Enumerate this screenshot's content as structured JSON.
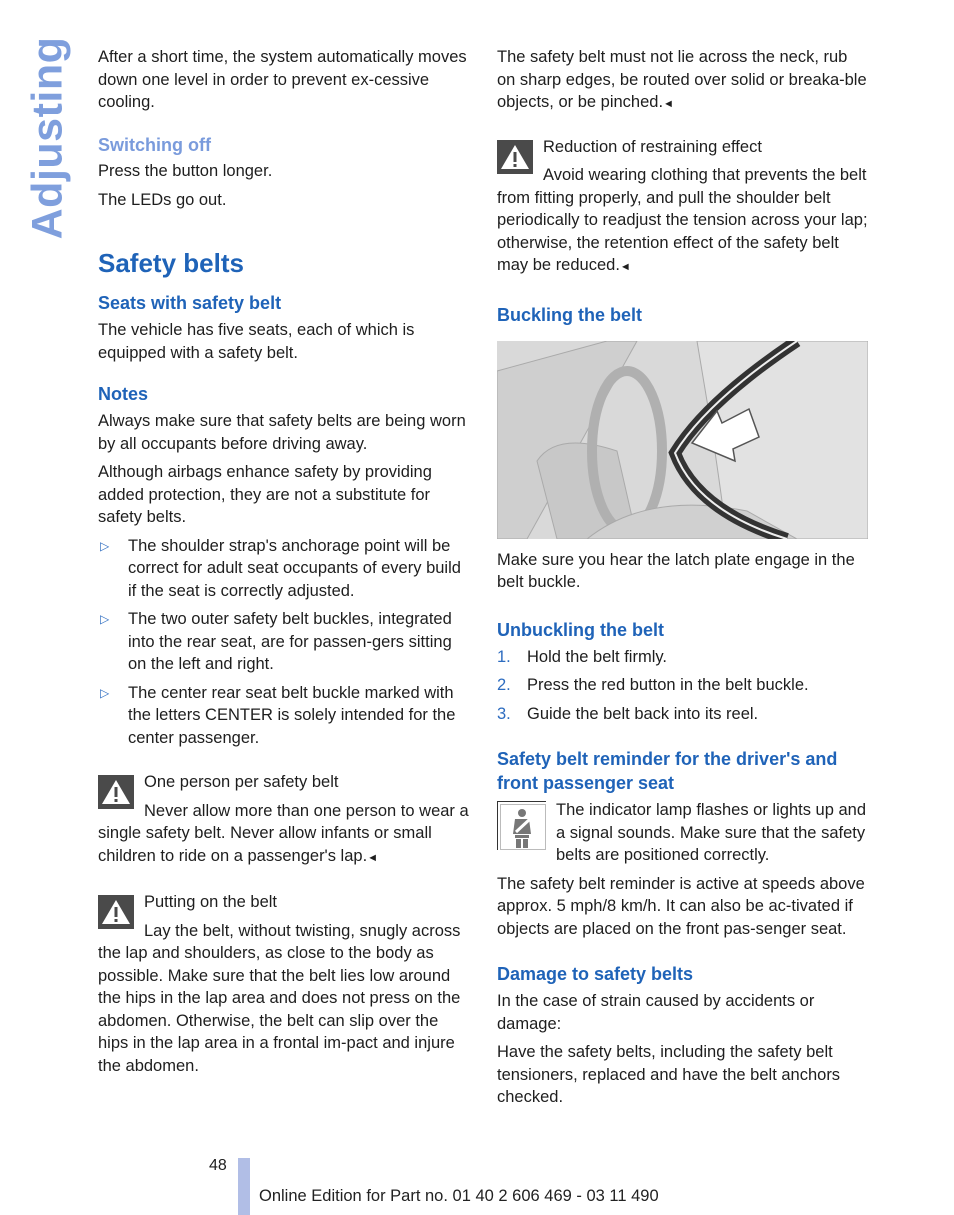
{
  "side_tab": {
    "label": "Adjusting"
  },
  "left": {
    "intro": "After a short time, the system automatically moves down one level in order to prevent ex-cessive cooling.",
    "switching_off": {
      "heading": "Switching off",
      "p1": "Press the button longer.",
      "p2": "The LEDs go out."
    },
    "section_title": "Safety belts",
    "seats": {
      "heading": "Seats with safety belt",
      "text": "The vehicle has five seats, each of which is equipped with a safety belt."
    },
    "notes": {
      "heading": "Notes",
      "p1": "Always make sure that safety belts are being worn by all occupants before driving away.",
      "p2": "Although airbags enhance safety by providing added protection, they are not a substitute for safety belts.",
      "bullets": [
        "The shoulder strap's anchorage point will be correct for adult seat occupants of every build if the seat is correctly adjusted.",
        "The two outer safety belt buckles, integrated into the rear seat, are for passen-gers sitting on the left and right.",
        "The center rear seat belt buckle marked with the letters CENTER is solely intended for the center passenger."
      ],
      "bullet_mark": "▷"
    },
    "warning1": {
      "title": "One person per safety belt",
      "text": "Never allow more than one person to wear a single safety belt. Never allow infants or small children to ride on a passenger's lap."
    },
    "warning2": {
      "title": "Putting on the belt",
      "text": "Lay the belt, without twisting, snugly across the lap and shoulders, as close to the body as possible. Make sure that the belt lies low around the hips in the lap area and does not press on the abdomen. Otherwise, the belt can slip over the hips in the lap area in a frontal im-pact and injure the abdomen."
    }
  },
  "right": {
    "warning2_cont": "The safety belt must not lie across the neck, rub on sharp edges, be routed over solid or breaka-ble objects, or be pinched.",
    "warning3": {
      "title": "Reduction of restraining effect",
      "text": "Avoid wearing clothing that prevents the belt from fitting properly, and pull the shoulder belt periodically to readjust the tension across your lap; otherwise, the retention effect of the safety belt may be reduced."
    },
    "buckling": {
      "heading": "Buckling the belt",
      "caption": "Make sure you hear the latch plate engage in the belt buckle."
    },
    "unbuckling": {
      "heading": "Unbuckling the belt",
      "steps": [
        {
          "num": "1.",
          "text": "Hold the belt firmly."
        },
        {
          "num": "2.",
          "text": "Press the red button in the belt buckle."
        },
        {
          "num": "3.",
          "text": "Guide the belt back into its reel."
        }
      ]
    },
    "reminder": {
      "heading": "Safety belt reminder for the driver's and front passenger seat",
      "lamp_text": "The indicator lamp flashes or lights up and a signal sounds. Make sure that the safety belts are positioned correctly.",
      "text": "The safety belt reminder is active at speeds above approx. 5 mph/8 km/h. It can also be ac-tivated if objects are placed on the front pas-senger seat."
    },
    "damage": {
      "heading": "Damage to safety belts",
      "p1": "In the case of strain caused by accidents or damage:",
      "p2": "Have the safety belts, including the safety belt tensioners, replaced and have the belt anchors checked."
    }
  },
  "end_mark": "◄",
  "footer": {
    "page_number": "48",
    "edition": "Online Edition for Part no. 01 40 2 606 469 - 03 11 490"
  }
}
